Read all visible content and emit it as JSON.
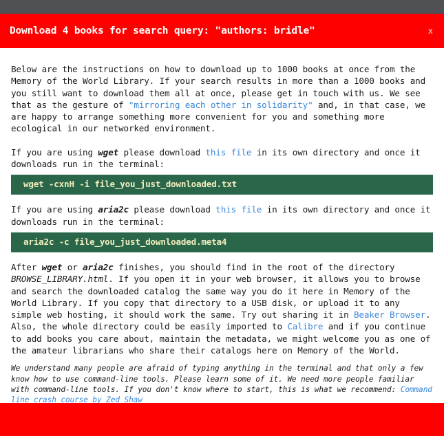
{
  "banner": {
    "title": "Download 4 books for search query: \"authors: bridle\"",
    "close_label": "x",
    "background_color": "#fe0000",
    "text_color": "#ffffff"
  },
  "topbar": {
    "background_color": "#4e5053"
  },
  "bottombar": {
    "background_color": "#fe0000"
  },
  "colors": {
    "link": "#3b87d8",
    "code_background": "#2a6649",
    "code_text": "#f2efc0",
    "body_text": "#1a1a1a"
  },
  "intro": {
    "part1": "Below are the instructions on how to download up to 1000 books at once from the Memory of the World Library. If your search results in more than a 1000 books and you still want to download them all at once, please get in touch with us. We see that as the gesture of ",
    "link": "\"mirroring each other in solidarity\"",
    "part2": " and, in that case, we are happy to arrange something more convenient for you and something more ecological in our networked environment."
  },
  "wget_section": {
    "part1": "If you are using ",
    "tool": "wget",
    "part2": " please download ",
    "link": "this file",
    "part3": " in its own directory and once it downloads run in the terminal:",
    "command": "wget -cxnH -i file_you_just_downloaded.txt"
  },
  "aria2c_section": {
    "part1": "If you are using ",
    "tool": "aria2c",
    "part2": " please download ",
    "link": "this file",
    "part3": " in its own directory and once it downloads run in the terminal:",
    "command": "aria2c -c file_you_just_downloaded.meta4"
  },
  "after_section": {
    "part1": "After ",
    "tool1": "wget",
    "part2": " or ",
    "tool2": "aria2c",
    "part3": " finishes, you should find in the root of the directory ",
    "file": "BROWSE_LIBRARY.html",
    "part4": ". If you open it in your web browser, it allows you to browse and search the downloaded catalog the same way you do it here in Memory of the World Library. If you copy that directory to a USB disk, or upload it to any simple web hosting, it should work the same. Try out sharing it in ",
    "link1": "Beaker Browser",
    "part5": ". Also, the whole directory could be easily imported to ",
    "link2": "Calibre",
    "part6": " and if you continue to add books you care about, maintain the metadata, we might welcome you as one of the amateur librarians who share their catalogs here on Memory of the World."
  },
  "note_section": {
    "part1": "We understand many people are afraid of typing anything in the terminal and that only a few know how to use command-line tools. Please learn some of it. We need more people familiar with command-line tools. If you don't know where to start, this is what we recommend: ",
    "link": "Command line crash course by Zed Shaw"
  }
}
